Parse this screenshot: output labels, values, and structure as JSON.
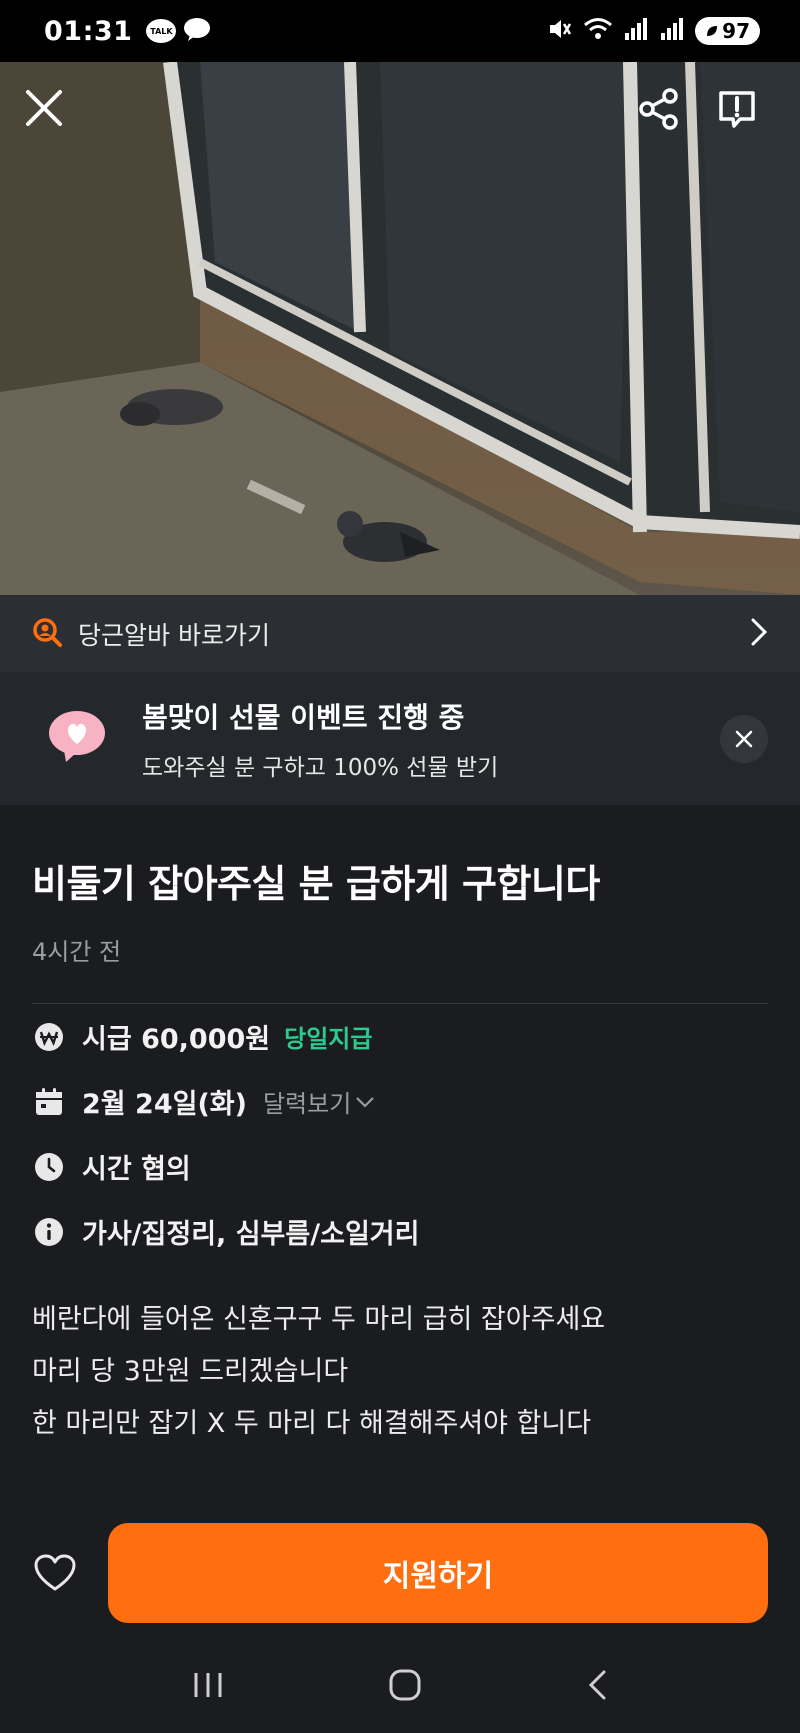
{
  "status_bar": {
    "time": "01:31",
    "talk_badge": "TALK",
    "battery": "97"
  },
  "quicklink": {
    "label": "당근알바 바로가기"
  },
  "promo": {
    "title": "봄맞이 선물 이벤트 진행 중",
    "subtitle": "도와주실 분 구하고 100% 선물 받기"
  },
  "post": {
    "title": "비둘기 잡아주실 분 급하게 구합니다",
    "posted": "4시간 전",
    "wage": "시급 60,000원",
    "pay_badge": "당일지급",
    "date": "2월 24일(화)",
    "calendar_link": "달력보기",
    "time": "시간 협의",
    "category": "가사/집정리, 심부름/소일거리",
    "description": [
      "베란다에 들어온 신혼구구 두 마리 급히 잡아주세요",
      "마리 당 3만원 드리겠습니다",
      "한 마리만 잡기 X 두 마리 다 해결해주셔야 합니다"
    ]
  },
  "actions": {
    "apply_label": "지원하기"
  },
  "colors": {
    "accent": "#ff6f0f",
    "pay_badge": "#2ec98e",
    "background": "#1b1c1f"
  }
}
